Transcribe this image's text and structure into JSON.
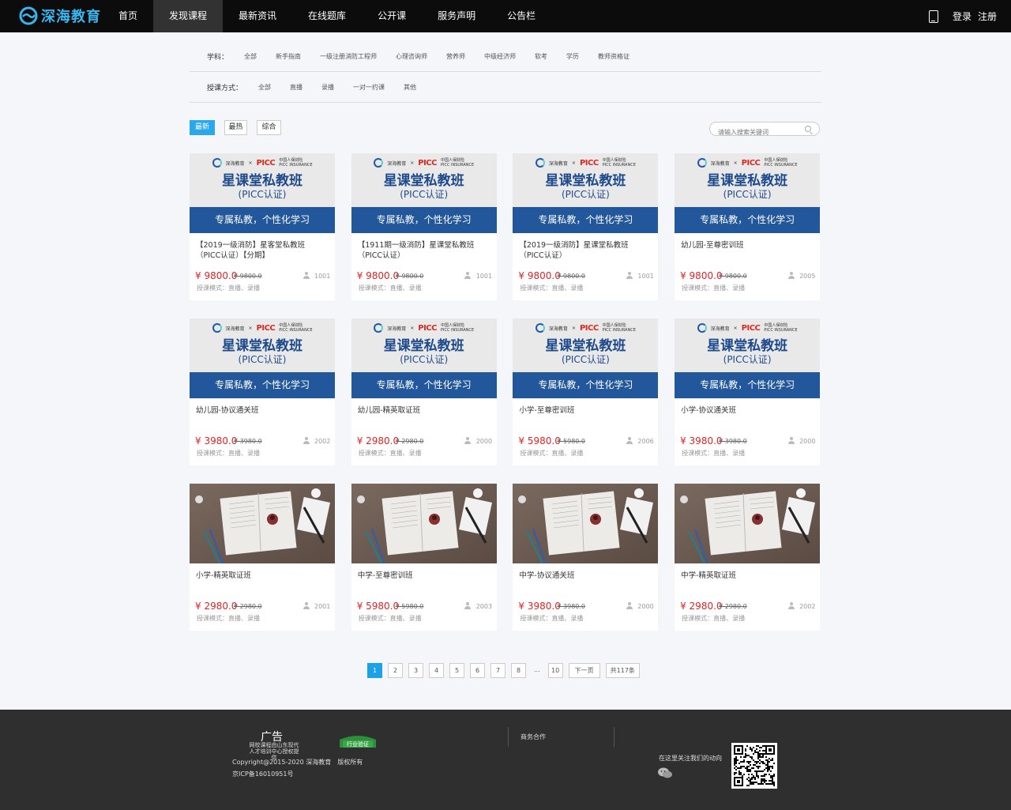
{
  "brand": {
    "name": "深海教育",
    "color": "#39b6ee"
  },
  "nav": {
    "items": [
      "首页",
      "发现课程",
      "最新资讯",
      "在线题库",
      "公开课",
      "服务声明",
      "公告栏"
    ],
    "active_index": 1,
    "login": "登录",
    "register": "注册"
  },
  "filters": {
    "subject_label": "学科：",
    "subjects": [
      "全部",
      "新手指南",
      "一级注册消防工程师",
      "心理咨询师",
      "营养师",
      "中级经济师",
      "软考",
      "学历",
      "教师资格证"
    ],
    "mode_label": "授课方式：",
    "modes": [
      "全部",
      "直播",
      "录播",
      "一对一约课",
      "其他"
    ]
  },
  "sort": {
    "options": [
      "最新",
      "最热",
      "综合"
    ],
    "active_index": 0,
    "search_placeholder": "请输入搜索关键词"
  },
  "banner": {
    "title": "星课堂私教班",
    "subtitle": "(PICC认证)",
    "strip": "专属私教，个性化学习",
    "partner_x": "×",
    "partner": "PICC",
    "partner_cn": "中国人保财险",
    "partner_en": "PICC INSURANCE",
    "brand_mini": "深海教育"
  },
  "courses": [
    {
      "title": "【2019一级消防】星客堂私教班（PICC认证）【分期】",
      "price": "¥ 9800.0",
      "old_price": "¥ 9800.0",
      "students": "1001",
      "mode": "授课模式：直播、录播",
      "banner": "picc"
    },
    {
      "title": "【1911期一级消防】星课堂私教班（PICC认证）",
      "price": "¥ 9800.0",
      "old_price": "¥ 9800.0",
      "students": "1001",
      "mode": "授课模式：直播、录播",
      "banner": "picc"
    },
    {
      "title": "【2019一级消防】星课堂私教班（PICC认证）",
      "price": "¥ 9800.0",
      "old_price": "¥ 9800.0",
      "students": "1001",
      "mode": "授课模式：直播、录播",
      "banner": "picc"
    },
    {
      "title": "幼儿园-至尊密训班",
      "price": "¥ 9800.0",
      "old_price": "¥ 9800.0",
      "students": "2005",
      "mode": "授课模式：直播、录播",
      "banner": "picc"
    },
    {
      "title": "幼儿园-协议通关班",
      "price": "¥ 3980.0",
      "old_price": "¥ 3980.0",
      "students": "2002",
      "mode": "授课模式：直播、录播",
      "banner": "picc"
    },
    {
      "title": "幼儿园-精英取证班",
      "price": "¥ 2980.0",
      "old_price": "¥ 2980.0",
      "students": "2000",
      "mode": "授课模式：直播、录播",
      "banner": "picc"
    },
    {
      "title": "小学-至尊密训班",
      "price": "¥ 5980.0",
      "old_price": "¥ 5980.0",
      "students": "2006",
      "mode": "授课模式：直播、录播",
      "banner": "picc"
    },
    {
      "title": "小学-协议通关班",
      "price": "¥ 3980.0",
      "old_price": "¥ 3980.0",
      "students": "2000",
      "mode": "授课模式：直播、录播",
      "banner": "picc"
    },
    {
      "title": "小学-精英取证班",
      "price": "¥ 2980.0",
      "old_price": "¥ 2980.0",
      "students": "2001",
      "mode": "授课模式：直播、录播",
      "banner": "desk"
    },
    {
      "title": "中学-至尊密训班",
      "price": "¥ 5980.0",
      "old_price": "¥ 5980.0",
      "students": "2003",
      "mode": "授课模式：直播、录播",
      "banner": "desk"
    },
    {
      "title": "中学-协议通关班",
      "price": "¥ 3980.0",
      "old_price": "¥ 3980.0",
      "students": "2000",
      "mode": "授课模式：直播、录播",
      "banner": "desk"
    },
    {
      "title": "中学-精英取证班",
      "price": "¥ 2980.0",
      "old_price": "¥ 2980.0",
      "students": "2002",
      "mode": "授课模式：直播、录播",
      "banner": "desk"
    }
  ],
  "pagination": {
    "pages": [
      "1",
      "2",
      "3",
      "4",
      "5",
      "6",
      "7",
      "8"
    ],
    "active_index": 0,
    "dots": "...",
    "last": "10",
    "next": "下一页",
    "total": "共117条"
  },
  "footer": {
    "ad_title": "广告",
    "ad_line1": "网校课程由山东现代",
    "ad_line2": "人才培训中心授权提供",
    "badge": "行业验证",
    "copyright": "Copyright@2015-2020 深海教育　版权所有",
    "icp": "京ICP备16010951号",
    "biz": "商务合作",
    "follow": "在这里关注我们的动向"
  },
  "icons": [
    "logo-icon",
    "tablet-icon",
    "search-icon",
    "user-icon",
    "wechat-icon",
    "qr-code"
  ]
}
